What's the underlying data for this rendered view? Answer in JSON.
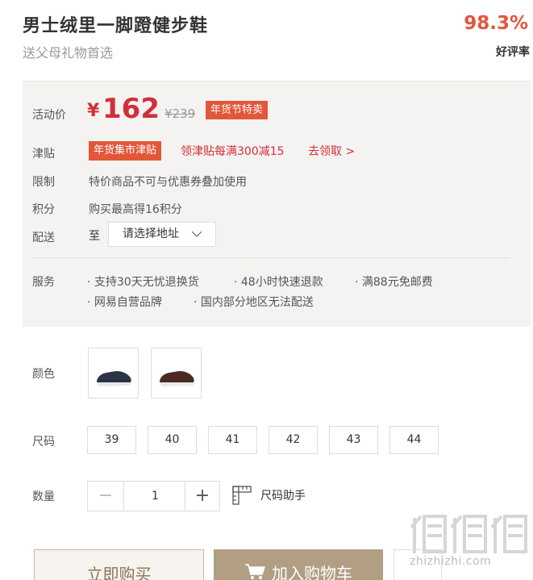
{
  "product": {
    "title": "男士绒里一脚蹬健步鞋",
    "subtitle": "送父母礼物首选",
    "rating": "98.3%",
    "rating_label": "好评率"
  },
  "price": {
    "label": "活动价",
    "currency": "¥",
    "value": "162",
    "original": "¥239",
    "promo_tag": "年货节特卖"
  },
  "coupon": {
    "label": "津贴",
    "tag": "年货集市津贴",
    "text": "领津贴每满300减15",
    "link": "去领取 >"
  },
  "limit": {
    "label": "限制",
    "text": "特价商品不可与优惠券叠加使用"
  },
  "points": {
    "label": "积分",
    "text": "购买最高得16积分"
  },
  "delivery": {
    "label": "配送",
    "to": "至",
    "select": "请选择地址"
  },
  "service": {
    "label": "服务",
    "items": [
      "· 支持30天无忧退换货",
      "· 48小时快速退款",
      "· 满88元免邮费",
      "· 网易自营品牌",
      "· 国内部分地区无法配送"
    ]
  },
  "color": {
    "label": "颜色"
  },
  "sizes": {
    "label": "尺码",
    "options": [
      "39",
      "40",
      "41",
      "42",
      "43",
      "44"
    ]
  },
  "quantity": {
    "label": "数量",
    "value": "1",
    "minus": "−",
    "plus": "+",
    "helper": "尺码助手"
  },
  "actions": {
    "buy": "立即购买",
    "cart": "加入购物车"
  },
  "watermark": {
    "text": "zhizhizhi.com"
  }
}
